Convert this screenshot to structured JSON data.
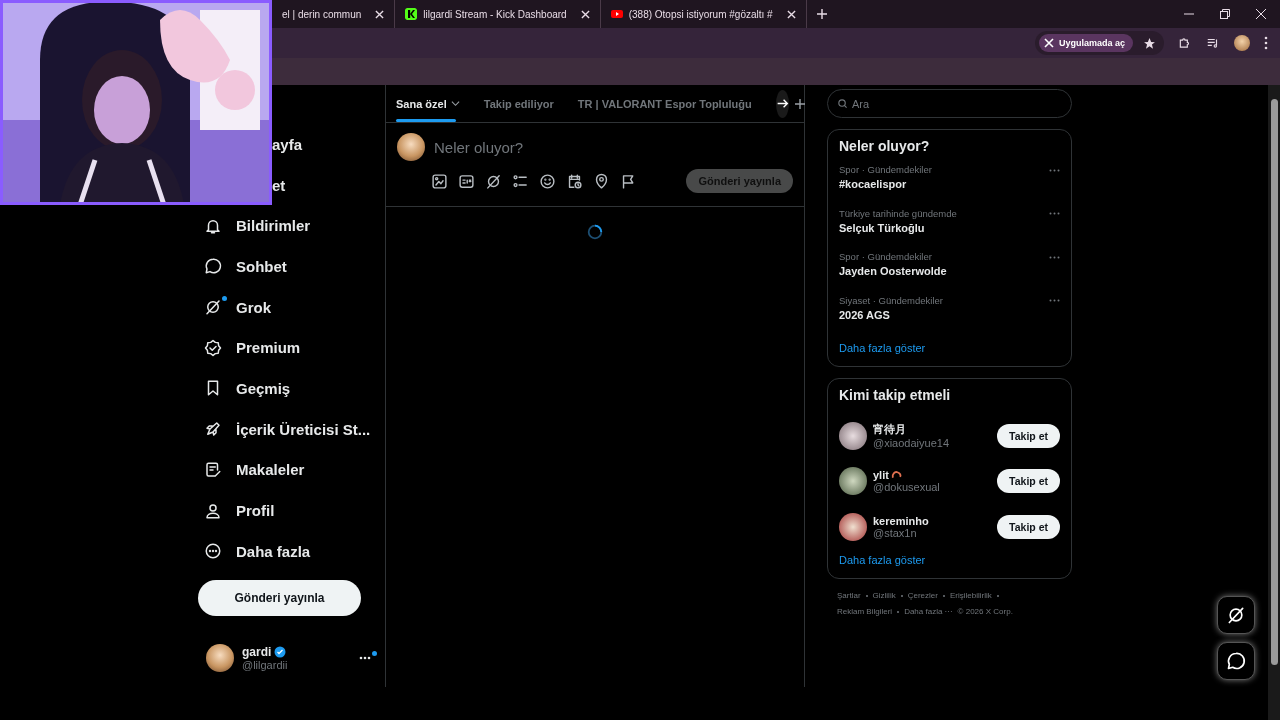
{
  "browser": {
    "tabs": [
      {
        "title": "el | derin commun",
        "kind": "plain"
      },
      {
        "title": "lilgardi Stream - Kick Dashboard",
        "kind": "kick"
      },
      {
        "title": "(388) Otopsi istiyorum #gözaltı #",
        "kind": "video"
      }
    ],
    "open_in_app": "Uygulamada aç"
  },
  "sidebar": {
    "items": [
      {
        "label": "ayfa",
        "covered": true,
        "badge": false
      },
      {
        "label": "et",
        "covered": true,
        "badge": false
      },
      {
        "label": "Bildirimler",
        "covered": false,
        "badge": false
      },
      {
        "label": "Sohbet",
        "covered": false,
        "badge": false
      },
      {
        "label": "Grok",
        "covered": false,
        "badge": true
      },
      {
        "label": "Premium",
        "covered": false,
        "badge": false
      },
      {
        "label": "Geçmiş",
        "covered": false,
        "badge": false
      },
      {
        "label": "İçerik Üreticisi St...",
        "covered": false,
        "badge": false
      },
      {
        "label": "Makaleler",
        "covered": false,
        "badge": false
      },
      {
        "label": "Profil",
        "covered": false,
        "badge": false
      },
      {
        "label": "Daha fazla",
        "covered": false,
        "badge": false
      }
    ],
    "post_button": "Gönderi yayınla",
    "account": {
      "name": "gardi",
      "verified": true,
      "handle": "@lilgardii",
      "notification": true
    }
  },
  "feed": {
    "tabs": [
      {
        "label": "Sana özel",
        "selected": true,
        "dropdown": true
      },
      {
        "label": "Takip ediliyor",
        "selected": false,
        "dropdown": false
      },
      {
        "label": "TR | VALORANT Espor Topluluğu",
        "selected": false,
        "dropdown": false
      }
    ],
    "composer": {
      "placeholder": "Neler oluyor?",
      "post_button": "Gönderi yayınla",
      "disabled": true
    },
    "loading": true
  },
  "search": {
    "placeholder": "Ara"
  },
  "trends": {
    "title": "Neler oluyor?",
    "items": [
      {
        "context": "Spor · Gündemdekiler",
        "topic": "#kocaelispor"
      },
      {
        "context": "Türkiye tarihinde gündemde",
        "topic": "Selçuk Türkoğlu"
      },
      {
        "context": "Spor · Gündemdekiler",
        "topic": "Jayden Oosterwolde"
      },
      {
        "context": "Siyaset · Gündemdekiler",
        "topic": "2026 AGS"
      }
    ],
    "more": "Daha fazla göster"
  },
  "who_to_follow": {
    "title": "Kimi takip etmeli",
    "users": [
      {
        "name": "宵待月",
        "handle": "@xiaodaiyue14",
        "emoji": false,
        "button": "Takip et"
      },
      {
        "name": "ylit",
        "handle": "@dokusexual",
        "emoji": true,
        "button": "Takip et"
      },
      {
        "name": "kereminho",
        "handle": "@stax1n",
        "emoji": false,
        "button": "Takip et"
      }
    ],
    "more": "Daha fazla göster"
  },
  "footer": {
    "lines": [
      [
        {
          "text": "Şartlar",
          "dot_after": true
        },
        {
          "text": "Gizlilik",
          "dot_after": true
        },
        {
          "text": "Çerezler",
          "dot_after": true
        },
        {
          "text": "Erişilebilirlik",
          "dot_after": true
        }
      ],
      [
        {
          "text": "Reklam Bilgileri",
          "dot_after": true
        },
        {
          "text": "Daha fazla ···",
          "dot_after": false
        },
        {
          "text": "© 2026 X Corp.",
          "dot_after": false
        }
      ]
    ]
  }
}
